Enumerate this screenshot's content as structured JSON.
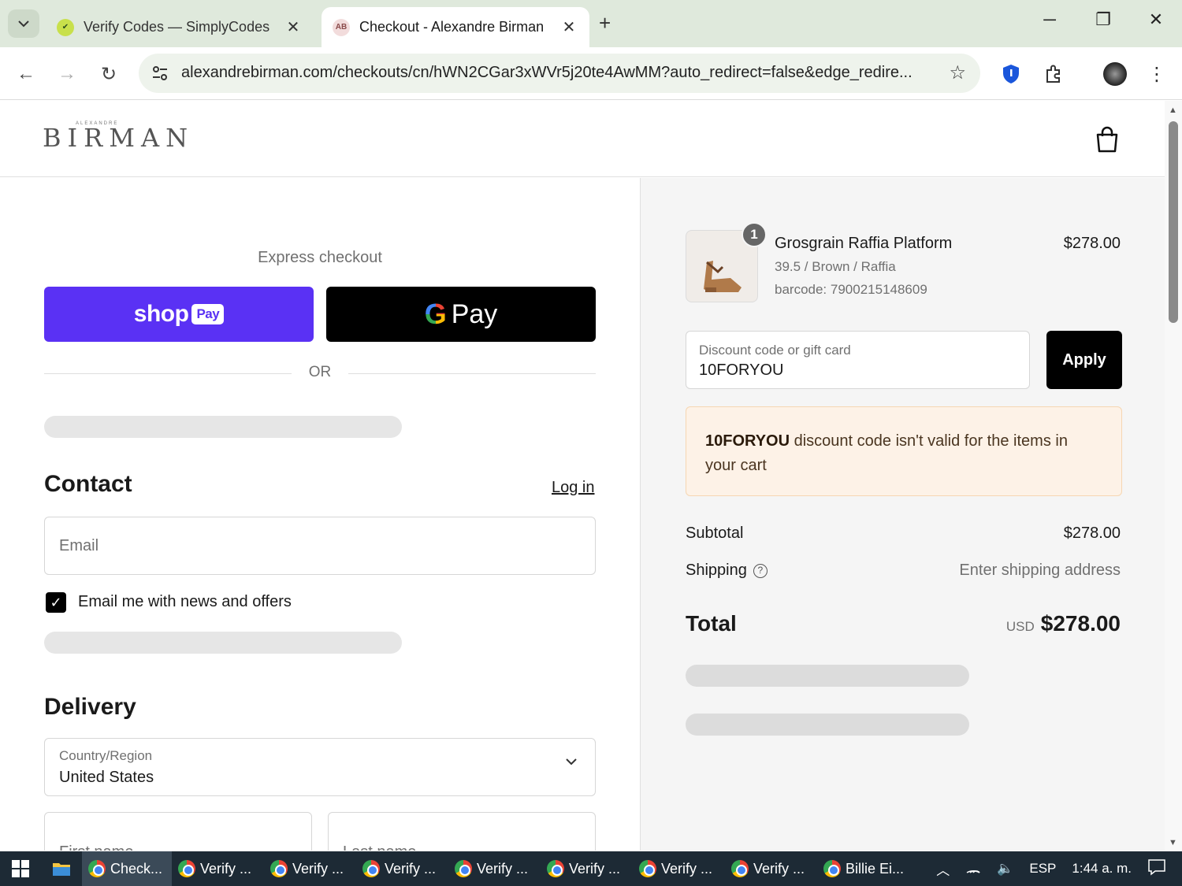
{
  "browser": {
    "tabs": [
      {
        "title": "Verify Codes — SimplyCodes",
        "favicon": "simplycodes-icon"
      },
      {
        "title": "Checkout - Alexandre Birman",
        "favicon_text": "AB"
      }
    ],
    "url": "alexandrebirman.com/checkouts/cn/hWN2CGar3xWVr5j20te4AwMM?auto_redirect=false&edge_redire..."
  },
  "header": {
    "logo": "BIRMAN",
    "logo_top": "ALEXANDRE"
  },
  "express": {
    "label": "Express checkout",
    "shoppay_text": "shop",
    "shoppay_badge": "Pay",
    "gpay_g": "G",
    "gpay_text": "Pay",
    "or": "OR"
  },
  "contact": {
    "heading": "Contact",
    "login": "Log in",
    "email_placeholder": "Email",
    "newsletter_label": "Email me with news and offers",
    "newsletter_checked": true
  },
  "delivery": {
    "heading": "Delivery",
    "country_label": "Country/Region",
    "country_value": "United States",
    "first_name_placeholder": "First name",
    "last_name_placeholder": "Last name"
  },
  "summary": {
    "item": {
      "qty": "1",
      "name": "Grosgrain Raffia Platform",
      "variant": "39.5 / Brown / Raffia",
      "barcode": "barcode: 7900215148609",
      "price": "$278.00"
    },
    "discount": {
      "label": "Discount code or gift card",
      "value": "10FORYOU",
      "apply": "Apply"
    },
    "alert": {
      "code": "10FORYOU",
      "message": " discount code isn't valid for the items in your cart"
    },
    "subtotal_label": "Subtotal",
    "subtotal_value": "$278.00",
    "shipping_label": "Shipping",
    "shipping_value": "Enter shipping address",
    "total_label": "Total",
    "total_currency": "USD",
    "total_value": "$278.00"
  },
  "taskbar": {
    "apps": [
      "Check...",
      "Verify ...",
      "Verify ...",
      "Verify ...",
      "Verify ...",
      "Verify ...",
      "Verify ...",
      "Verify ...",
      "Billie Ei..."
    ],
    "language": "ESP",
    "time": "1:44 a. m."
  },
  "colors": {
    "shoppay": "#5a31f4",
    "alert_bg": "#fdf2e7",
    "alert_border": "#f6d6b2"
  }
}
